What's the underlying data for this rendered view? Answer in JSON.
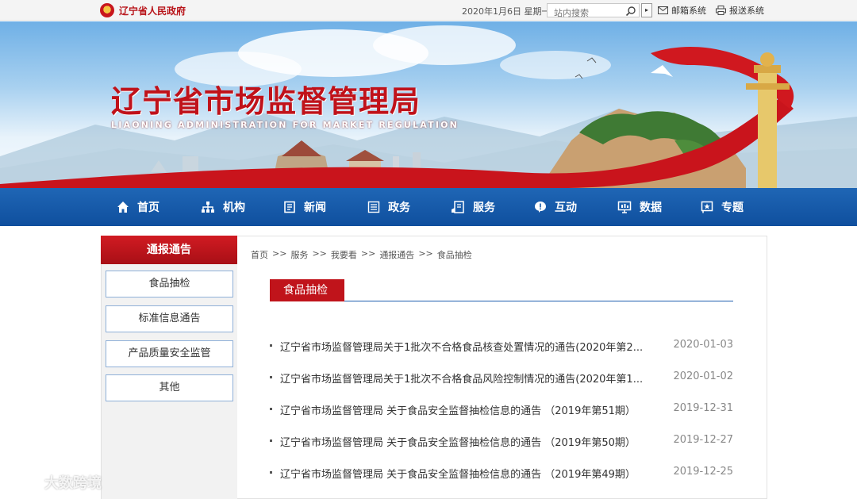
{
  "topbar": {
    "gov_name": "辽宁省人民政府",
    "date": "2020年1月6日 星期一",
    "search_placeholder": "站内搜索",
    "search_button": "▸",
    "mail_label": "邮箱系统",
    "report_label": "报送系统"
  },
  "banner": {
    "title": "辽宁省市场监督管理局",
    "subtitle": "LIAONING ADMINISTRATION FOR MARKET REGULATION"
  },
  "nav": {
    "items": [
      {
        "label": "首页",
        "icon": "home-icon"
      },
      {
        "label": "机构",
        "icon": "org-chart-icon"
      },
      {
        "label": "新闻",
        "icon": "news-icon"
      },
      {
        "label": "政务",
        "icon": "list-icon"
      },
      {
        "label": "服务",
        "icon": "service-icon"
      },
      {
        "label": "互动",
        "icon": "interact-icon"
      },
      {
        "label": "数据",
        "icon": "data-icon"
      },
      {
        "label": "专题",
        "icon": "topic-icon"
      }
    ]
  },
  "sidebar": {
    "heading": "通报通告",
    "items": [
      {
        "label": "食品抽检"
      },
      {
        "label": "标准信息通告"
      },
      {
        "label": "产品质量安全监管"
      },
      {
        "label": "其他"
      }
    ]
  },
  "breadcrumb": [
    "首页",
    "服务",
    "我要看",
    "通报通告",
    "食品抽检"
  ],
  "breadcrumb_sep": ">>",
  "section_title": "食品抽检",
  "articles": [
    {
      "title": "辽宁省市场监督管理局关于1批次不合格食品核查处置情况的通告(2020年第2...",
      "date": "2020-01-03"
    },
    {
      "title": "辽宁省市场监督管理局关于1批次不合格食品风险控制情况的通告(2020年第1...",
      "date": "2020-01-02"
    },
    {
      "title": "辽宁省市场监督管理局 关于食品安全监督抽检信息的通告 （2019年第51期）",
      "date": "2019-12-31"
    },
    {
      "title": "辽宁省市场监督管理局 关于食品安全监督抽检信息的通告 （2019年第50期）",
      "date": "2019-12-27"
    },
    {
      "title": "辽宁省市场监督管理局 关于食品安全监督抽检信息的通告 （2019年第49期）",
      "date": "2019-12-25"
    }
  ],
  "watermark": "大数跨境",
  "colors": {
    "brand_red": "#c0141b",
    "nav_blue": "#1a5fae",
    "sidebar_border": "#8fb0d8"
  }
}
